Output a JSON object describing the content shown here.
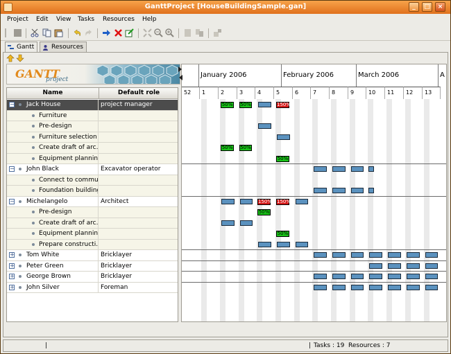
{
  "window": {
    "title": "GanttProject [HouseBuildingSample.gan]"
  },
  "menu": [
    "Project",
    "Edit",
    "View",
    "Tasks",
    "Resources",
    "Help"
  ],
  "tabs": [
    {
      "label": "Gantt"
    },
    {
      "label": "Resources"
    }
  ],
  "logo": {
    "title": "GANTT",
    "subtitle": "project"
  },
  "table": {
    "col_name": "Name",
    "col_role": "Default role"
  },
  "rows": [
    {
      "name": "Jack House",
      "role": "project manager",
      "type": "resource",
      "expanded": true,
      "selected": true
    },
    {
      "name": "Furniture",
      "role": "",
      "type": "task"
    },
    {
      "name": "Pre-design",
      "role": "",
      "type": "task"
    },
    {
      "name": "Furniture selection",
      "role": "",
      "type": "task"
    },
    {
      "name": "Create draft of arc...",
      "role": "",
      "type": "task"
    },
    {
      "name": "Equipment planning",
      "role": "",
      "type": "task"
    },
    {
      "name": "John Black",
      "role": "Excavator operator",
      "type": "resource",
      "expanded": true
    },
    {
      "name": "Connect to commu...",
      "role": "",
      "type": "task"
    },
    {
      "name": "Foundation building",
      "role": "",
      "type": "task"
    },
    {
      "name": "Michelangelo",
      "role": "Architect",
      "type": "resource",
      "expanded": true
    },
    {
      "name": "Pre-design",
      "role": "",
      "type": "task"
    },
    {
      "name": "Create draft of arc...",
      "role": "",
      "type": "task"
    },
    {
      "name": "Equipment planning",
      "role": "",
      "type": "task"
    },
    {
      "name": "Prepare constructi...",
      "role": "",
      "type": "task"
    },
    {
      "name": "Tom White",
      "role": "Bricklayer",
      "type": "resource",
      "expanded": false
    },
    {
      "name": "Peter Green",
      "role": "Bricklayer",
      "type": "resource",
      "expanded": false
    },
    {
      "name": "George Brown",
      "role": "Bricklayer",
      "type": "resource",
      "expanded": false
    },
    {
      "name": "John Silver",
      "role": "Foreman",
      "type": "resource",
      "expanded": false
    }
  ],
  "chart": {
    "months": [
      "January 2006",
      "February 2006",
      "March 2006",
      "A"
    ],
    "days": [
      "52",
      "1",
      "2",
      "3",
      "4",
      "5",
      "6",
      "7",
      "8",
      "9",
      "10",
      "11",
      "12",
      "13"
    ],
    "load_labels": [
      {
        "row": 0,
        "col": 2,
        "text": "50%",
        "color": "#18c418"
      },
      {
        "row": 0,
        "col": 3,
        "text": "50%",
        "color": "#18c418"
      },
      {
        "row": 0,
        "col": 5,
        "text": "150%",
        "color": "#d41818"
      },
      {
        "row": 4,
        "col": 2,
        "text": "50%",
        "color": "#18c418"
      },
      {
        "row": 4,
        "col": 3,
        "text": "50%",
        "color": "#18c418"
      },
      {
        "row": 5,
        "col": 5,
        "text": "50%",
        "color": "#18c418"
      },
      {
        "row": 9,
        "col": 4,
        "text": "150%",
        "color": "#d41818"
      },
      {
        "row": 9,
        "col": 5,
        "text": "150%",
        "color": "#d41818"
      },
      {
        "row": 10,
        "col": 4,
        "text": "50%",
        "color": "#18c418"
      },
      {
        "row": 12,
        "col": 5,
        "text": "50%",
        "color": "#18c418"
      }
    ]
  },
  "status": {
    "left": "|",
    "tasks": "Tasks : 19",
    "resources": "Resources : 7",
    "sep": "|"
  }
}
